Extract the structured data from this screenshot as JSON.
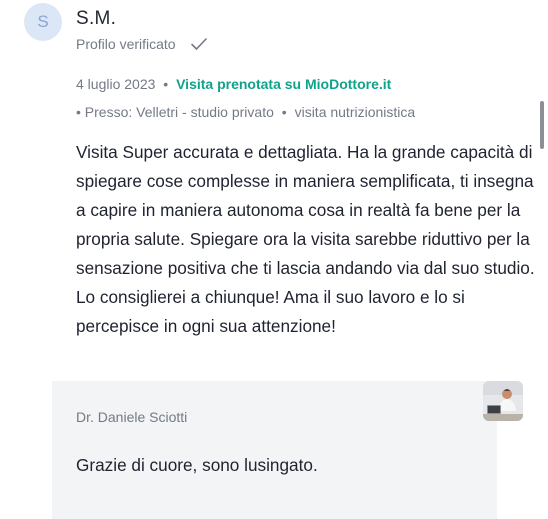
{
  "review": {
    "avatar_initial": "S",
    "author": "S.M.",
    "verified_label": "Profilo verificato",
    "date": "4 luglio 2023",
    "booking_label": "Visita prenotata su MioDottore.it",
    "location": "Presso: Velletri - studio privato",
    "visit_type": "visita nutrizionistica",
    "text": "Visita Super accurata e dettagliata. Ha la grande capacità di spiegare cose complesse in maniera semplificata, ti insegna a capire in maniera autonoma cosa in realtà fa bene per la propria salute. Spiegare ora la visita sarebbe riduttivo per la sensazione positiva che ti lascia andando via dal suo studio. Lo consiglierei a chiunque! Ama il suo lavoro e lo si percepisce in ogni sua attenzione!"
  },
  "reply": {
    "doctor_name": "Dr. Daniele Sciotti",
    "text": "Grazie di cuore, sono lusingato."
  },
  "icons": {
    "verified": "check-icon",
    "doctor": "doctor-photo"
  },
  "colors": {
    "accent": "#10a38c",
    "muted": "#737a86",
    "avatar_bg": "#dbe6f7",
    "reply_bg": "#f3f4f6"
  }
}
